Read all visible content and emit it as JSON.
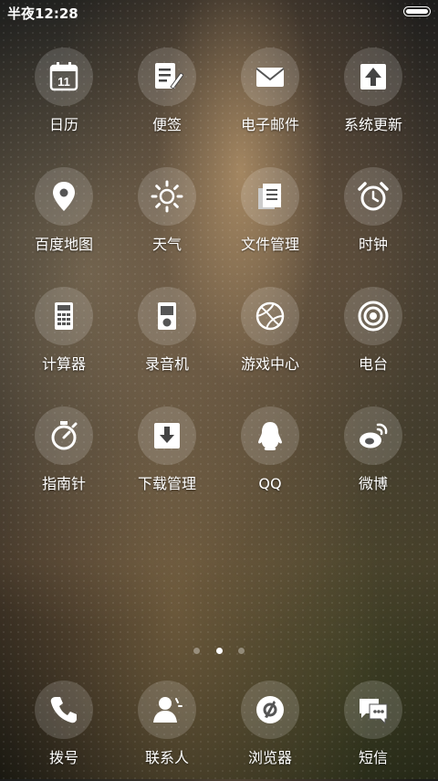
{
  "status_bar": {
    "time": "半夜12:28",
    "battery_icon": "battery-icon"
  },
  "apps": [
    {
      "label": "日历",
      "icon": "calendar-icon",
      "day": "11"
    },
    {
      "label": "便签",
      "icon": "notes-icon"
    },
    {
      "label": "电子邮件",
      "icon": "mail-icon"
    },
    {
      "label": "系统更新",
      "icon": "system-update-icon"
    },
    {
      "label": "百度地图",
      "icon": "map-pin-icon"
    },
    {
      "label": "天气",
      "icon": "weather-sun-icon"
    },
    {
      "label": "文件管理",
      "icon": "file-manager-icon"
    },
    {
      "label": "时钟",
      "icon": "alarm-clock-icon"
    },
    {
      "label": "计算器",
      "icon": "calculator-icon"
    },
    {
      "label": "录音机",
      "icon": "recorder-icon"
    },
    {
      "label": "游戏中心",
      "icon": "game-center-icon"
    },
    {
      "label": "电台",
      "icon": "radio-icon"
    },
    {
      "label": "指南针",
      "icon": "compass-icon"
    },
    {
      "label": "下载管理",
      "icon": "download-icon"
    },
    {
      "label": "QQ",
      "icon": "qq-penguin-icon"
    },
    {
      "label": "微博",
      "icon": "weibo-icon"
    }
  ],
  "pager": {
    "pages": 3,
    "active": 2
  },
  "dock": [
    {
      "label": "拨号",
      "icon": "phone-icon"
    },
    {
      "label": "联系人",
      "icon": "contacts-icon"
    },
    {
      "label": "浏览器",
      "icon": "browser-icon"
    },
    {
      "label": "短信",
      "icon": "sms-icon"
    }
  ]
}
